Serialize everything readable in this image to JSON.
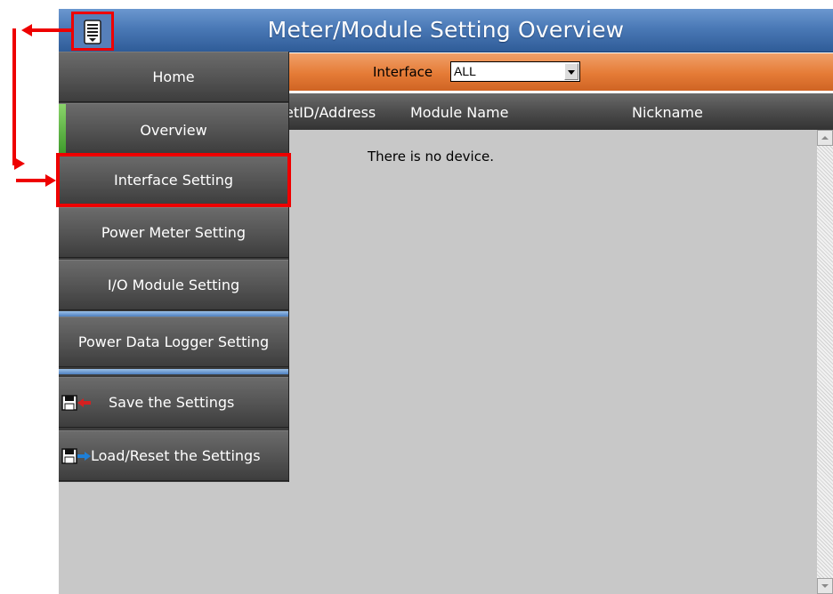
{
  "header": {
    "title": "Meter/Module Setting Overview",
    "menu_icon": "menu-list-icon"
  },
  "interface_filter": {
    "label": "Interface",
    "selected": "ALL"
  },
  "table": {
    "columns": [
      "NetID/Address",
      "Module Name",
      "Nickname"
    ],
    "empty_message": "There is no device."
  },
  "sidebar": {
    "items": [
      {
        "label": "Home"
      },
      {
        "label": "Overview",
        "active": true
      },
      {
        "label": "Interface Setting"
      },
      {
        "label": "Power Meter Setting"
      },
      {
        "label": "I/O Module Setting"
      },
      {
        "label": "Power Data Logger Setting"
      },
      {
        "label": "Save the Settings",
        "icon": "save-settings-icon"
      },
      {
        "label": "Load/Reset the Settings",
        "icon": "load-settings-icon"
      }
    ]
  },
  "colors": {
    "title_bar": "#4a79b6",
    "interface_bar": "#e57b36",
    "header_bar": "#4c4c4c",
    "content_bg": "#c8c8c8",
    "menu_bg": "#555555",
    "active_indicator": "#5ab83f",
    "separator": "#6e9dd6",
    "annotation": "#ee0000"
  }
}
